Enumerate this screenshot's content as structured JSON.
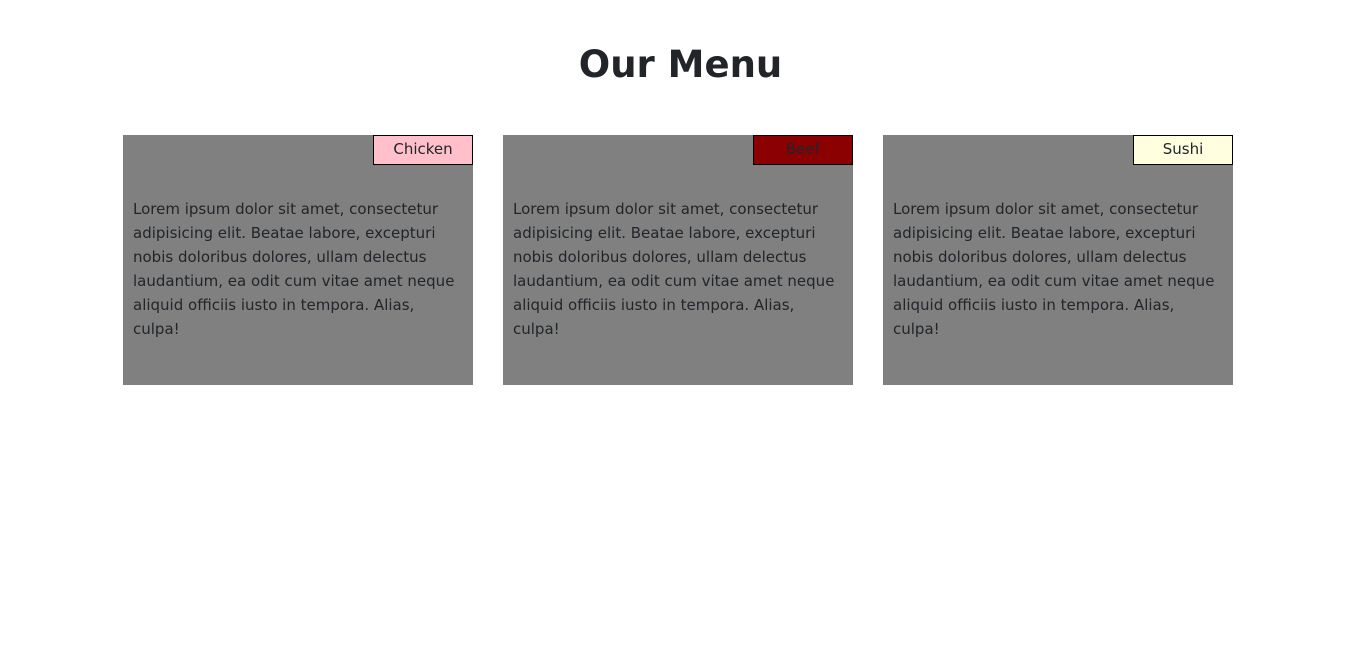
{
  "page": {
    "title": "Our Menu"
  },
  "menu": {
    "items": [
      {
        "tag": "Chicken",
        "tag_color": "#ffc0cb",
        "description": "Lorem ipsum dolor sit amet, consectetur adipisicing elit. Beatae labore, excepturi nobis doloribus dolores, ullam delectus laudantium, ea odit cum vitae amet neque aliquid officiis iusto in tempora. Alias, culpa!"
      },
      {
        "tag": "Beef",
        "tag_color": "#8b0000",
        "description": "Lorem ipsum dolor sit amet, consectetur adipisicing elit. Beatae labore, excepturi nobis doloribus dolores, ullam delectus laudantium, ea odit cum vitae amet neque aliquid officiis iusto in tempora. Alias, culpa!"
      },
      {
        "tag": "Sushi",
        "tag_color": "#ffffe0",
        "description": "Lorem ipsum dolor sit amet, consectetur adipisicing elit. Beatae labore, excepturi nobis doloribus dolores, ullam delectus laudantium, ea odit cum vitae amet neque aliquid officiis iusto in tempora. Alias, culpa!"
      }
    ],
    "card_background": "#808080"
  }
}
